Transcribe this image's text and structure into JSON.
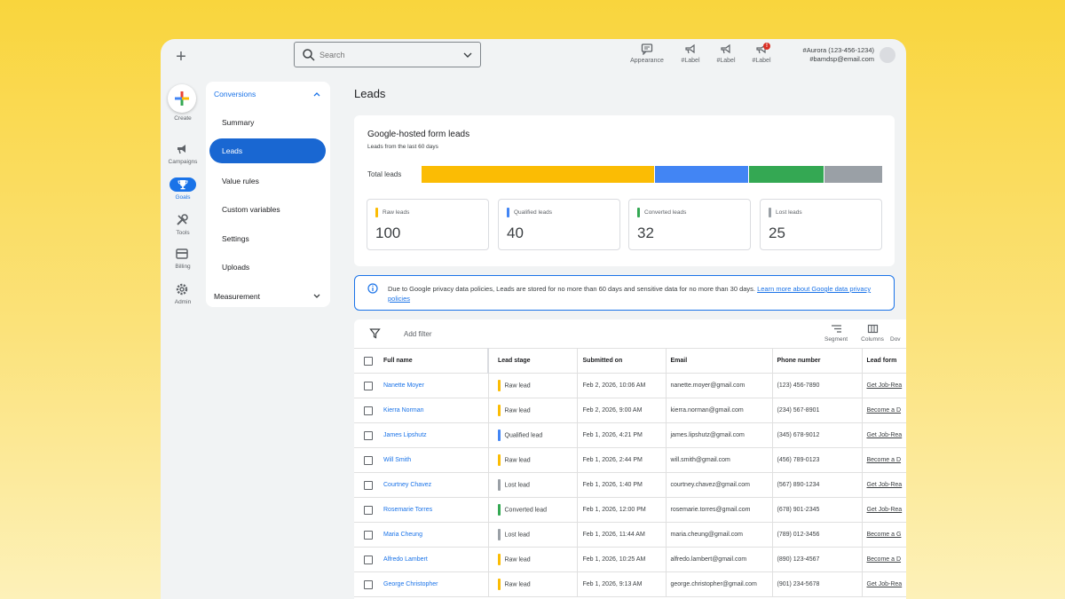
{
  "topbar": {
    "search_placeholder": "Search",
    "actions": [
      {
        "label": "Appearance",
        "icon": "feedback-icon"
      },
      {
        "label": "#Label",
        "icon": "megaphone-icon"
      },
      {
        "label": "#Label",
        "icon": "megaphone-icon"
      },
      {
        "label": "#Label",
        "icon": "megaphone-icon",
        "badge": "!"
      }
    ],
    "account_line1": "#Aurora (123-456-1234)",
    "account_line2": "#bamdsp@email.com"
  },
  "rail": {
    "create": "Create",
    "campaigns": "Campaigns",
    "goals": "Goals",
    "tools": "Tools",
    "billing": "Billing",
    "admin": "Admin"
  },
  "nav": {
    "section": "Conversions",
    "items": [
      "Summary",
      "Leads",
      "Value rules",
      "Custom variables",
      "Settings",
      "Uploads"
    ],
    "active": "Leads",
    "measurement": "Measurement"
  },
  "main": {
    "title": "Leads",
    "card_title": "Google-hosted form leads",
    "card_sub": "Leads from the last 60 days",
    "total_label": "Total leads",
    "stats": [
      {
        "label": "Raw leads",
        "value": "100",
        "color": "#fbbc04"
      },
      {
        "label": "Qualified leads",
        "value": "40",
        "color": "#4285f4"
      },
      {
        "label": "Converted leads",
        "value": "32",
        "color": "#34a853"
      },
      {
        "label": "Lost leads",
        "value": "25",
        "color": "#9aa0a6"
      }
    ],
    "notice_text": "Due to Google privacy data policies, Leads are stored for no more than 60 days and sensitive data for no more than 30 days. ",
    "notice_link": "Learn more about Google data privacy policies"
  },
  "table": {
    "add_filter": "Add filter",
    "tools": [
      "Segment",
      "Columns",
      "Dov"
    ],
    "headers": [
      "Full name",
      "Lead stage",
      "Submitted on",
      "Email",
      "Phone number",
      "Lead form"
    ],
    "rows": [
      {
        "name": "Nanette Moyer",
        "stage": "Raw lead",
        "stage_color": "#fbbc04",
        "submitted": "Feb 2, 2026, 10:06 AM",
        "email": "nanette.moyer@gmail.com",
        "phone": "(123) 456-7890",
        "form": "Get Job-Rea"
      },
      {
        "name": "Kierra Norman",
        "stage": "Raw lead",
        "stage_color": "#fbbc04",
        "submitted": "Feb 2, 2026, 9:00 AM",
        "email": "kierra.norman@gmail.com",
        "phone": "(234) 567-8901",
        "form": "Become a D"
      },
      {
        "name": "James Lipshutz",
        "stage": "Qualified lead",
        "stage_color": "#4285f4",
        "submitted": "Feb 1, 2026, 4:21 PM",
        "email": "james.lipshutz@gmail.com",
        "phone": "(345) 678-9012",
        "form": "Get Job-Rea"
      },
      {
        "name": "Will Smith",
        "stage": "Raw lead",
        "stage_color": "#fbbc04",
        "submitted": "Feb 1, 2026, 2:44 PM",
        "email": "will.smith@gmail.com",
        "phone": "(456) 789-0123",
        "form": "Become a D"
      },
      {
        "name": "Courtney Chavez",
        "stage": "Lost lead",
        "stage_color": "#9aa0a6",
        "submitted": "Feb 1, 2026, 1:40 PM",
        "email": "courtney.chavez@gmail.com",
        "phone": "(567) 890-1234",
        "form": "Get Job-Rea"
      },
      {
        "name": "Rosemarie Torres",
        "stage": "Converted lead",
        "stage_color": "#34a853",
        "submitted": "Feb 1, 2026, 12:00 PM",
        "email": "rosemarie.torres@gmail.com",
        "phone": "(678) 901-2345",
        "form": "Get Job-Rea"
      },
      {
        "name": "Maria Cheung",
        "stage": "Lost lead",
        "stage_color": "#9aa0a6",
        "submitted": "Feb 1, 2026, 11:44 AM",
        "email": "maria.cheung@gmail.com",
        "phone": "(789) 012-3456",
        "form": "Become a G"
      },
      {
        "name": "Alfredo Lambert",
        "stage": "Raw lead",
        "stage_color": "#fbbc04",
        "submitted": "Feb 1, 2026, 10:25 AM",
        "email": "alfredo.lambert@gmail.com",
        "phone": "(890) 123-4567",
        "form": "Become a D"
      },
      {
        "name": "George Christopher",
        "stage": "Raw lead",
        "stage_color": "#fbbc04",
        "submitted": "Feb 1, 2026, 9:13 AM",
        "email": "george.christopher@gmail.com",
        "phone": "(901) 234-5678",
        "form": "Get Job-Rea"
      }
    ]
  }
}
